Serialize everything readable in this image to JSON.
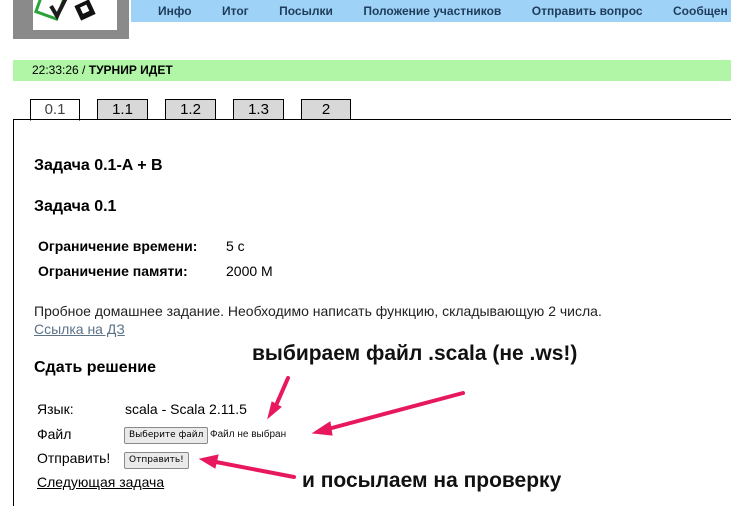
{
  "nav": {
    "items": [
      "Инфо",
      "Итог",
      "Посылки",
      "Положение участников",
      "Отправить вопрос",
      "Сообщен"
    ]
  },
  "status": {
    "time": "22:33:26",
    "separator": " / ",
    "state": "ТУРНИР ИДЕТ"
  },
  "tabs": [
    "0.1",
    "1.1",
    "1.2",
    "1.3",
    "2"
  ],
  "problem": {
    "header": "Задача 0.1-A + B",
    "subheader": "Задача 0.1",
    "time_limit_label": "Ограничение времени:",
    "time_limit_value": "5 с",
    "memory_limit_label": "Ограничение памяти:",
    "memory_limit_value": "2000 М",
    "description": "Пробное домашнее задание. Необходимо написать функцию, складывающую 2 числа.",
    "link": "Ссылка на ДЗ"
  },
  "submit": {
    "header": "Сдать решение",
    "language_label": "Язык:",
    "language_value": "scala - Scala 2.11.5",
    "file_label": "Файл",
    "choose_file_button": "Выберите файл",
    "no_file_text": "Файл не выбран",
    "send_label": "Отправить!",
    "send_button": "Отправить!",
    "next_link": "Следующая задача"
  },
  "annotations": {
    "top": "выбираем файл .scala (не .ws!)",
    "bottom": "и посылаем на проверку"
  },
  "colors": {
    "nav_bg": "#9fd2f7",
    "status_bg": "#b1f5a6",
    "arrow": "#e8185f"
  }
}
